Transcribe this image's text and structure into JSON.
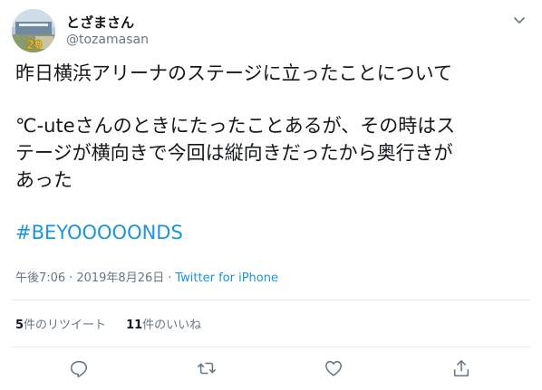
{
  "user": {
    "display_name": "とざまさん",
    "handle": "@tozamasan",
    "avatar_badge": "29"
  },
  "tweet": {
    "line1": "昨日横浜アリーナのステージに立ったことについて",
    "line2": "℃-uteさんのときにたったことあるが、その時はス",
    "line3": "テージが横向きで今回は縦向きだったから奥行きが",
    "line4": "あった",
    "hashtag": "#BEYOOOOONDS"
  },
  "meta": {
    "time": "午後7:06",
    "separator": "·",
    "date": "2019年8月26日",
    "separator2": "·",
    "source": "Twitter for iPhone"
  },
  "stats": {
    "retweets_count": "5",
    "retweets_label": "件のリツイート",
    "likes_count": "11",
    "likes_label": "件のいいね"
  },
  "actions": {
    "reply_icon": "reply-icon",
    "retweet_icon": "retweet-icon",
    "like_icon": "heart-icon",
    "share_icon": "share-icon"
  },
  "colors": {
    "link": "#1b95e0",
    "muted": "#657786",
    "text": "#14171a",
    "divider": "#e6ecf0"
  }
}
